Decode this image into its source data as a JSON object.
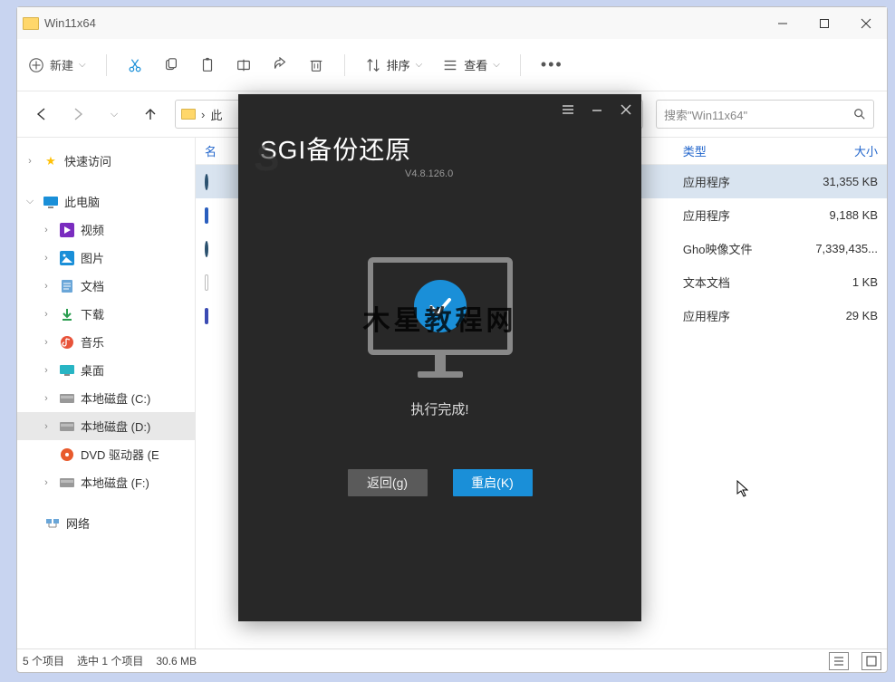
{
  "window": {
    "title": "Win11x64"
  },
  "toolbar": {
    "new": "新建",
    "sort": "排序",
    "view": "查看"
  },
  "breadcrumb": {
    "seg1": "›",
    "seg2": "此"
  },
  "search": {
    "placeholder": "搜索\"Win11x64\""
  },
  "sidebar": {
    "quick": "快速访问",
    "pc": "此电脑",
    "items": [
      {
        "label": "视频"
      },
      {
        "label": "图片"
      },
      {
        "label": "文档"
      },
      {
        "label": "下载"
      },
      {
        "label": "音乐"
      },
      {
        "label": "桌面"
      },
      {
        "label": "本地磁盘 (C:)"
      },
      {
        "label": "本地磁盘 (D:)"
      },
      {
        "label": "DVD 驱动器 (E"
      },
      {
        "label": "本地磁盘 (F:)"
      }
    ],
    "network": "网络"
  },
  "columns": {
    "name": "名",
    "type": "类型",
    "size": "大小"
  },
  "files": [
    {
      "type": "应用程序",
      "size": "31,355 KB",
      "ico": "#2a506e"
    },
    {
      "type": "应用程序",
      "size": "9,188 KB",
      "ico": "#2a5ebe"
    },
    {
      "type": "Gho映像文件",
      "size": "7,339,435...",
      "ico": "#2a506e"
    },
    {
      "type": "文本文档",
      "size": "1 KB",
      "ico": "#e8e8e8"
    },
    {
      "type": "应用程序",
      "size": "29 KB",
      "ico": "#3b4bb3"
    }
  ],
  "status": {
    "count": "5 个项目",
    "selected": "选中 1 个项目",
    "size": "30.6 MB"
  },
  "dialog": {
    "title": "SGI备份还原",
    "version": "V4.8.126.0",
    "done": "执行完成!",
    "watermark": "木星教程网",
    "back": "返回(g)",
    "restart": "重启(K)"
  }
}
